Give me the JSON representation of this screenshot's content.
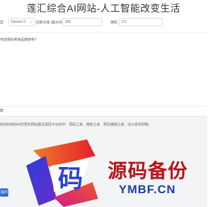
{
  "header": {
    "title": "莲汇综合AI网站-人工智能改变生活"
  },
  "settings": {
    "model_label": "型",
    "model_value": "Davinci-3",
    "max_tokens_label": "回复长度 (最大4096)",
    "max_tokens_value": "300",
    "temperature_label": "随机",
    "temperature_value": "0.5"
  },
  "prompt": {
    "value": "何选择好常用品牌家电?"
  },
  "answer": {
    "label": "数",
    "value": "如何利用好AI优秀的网站建设源码平台的作：源码之家、模板之家、网页编辑之家、设计素材网等。"
  },
  "actions": {
    "submit_label": "提问"
  },
  "watermark": {
    "brand": "源码备份",
    "domain": "YMBF.CN",
    "logo_char": "码"
  },
  "colors": {
    "watermark_red": "#b8131b",
    "watermark_blue": "#1b3ea6",
    "button_blue": "#2f6fd1"
  }
}
